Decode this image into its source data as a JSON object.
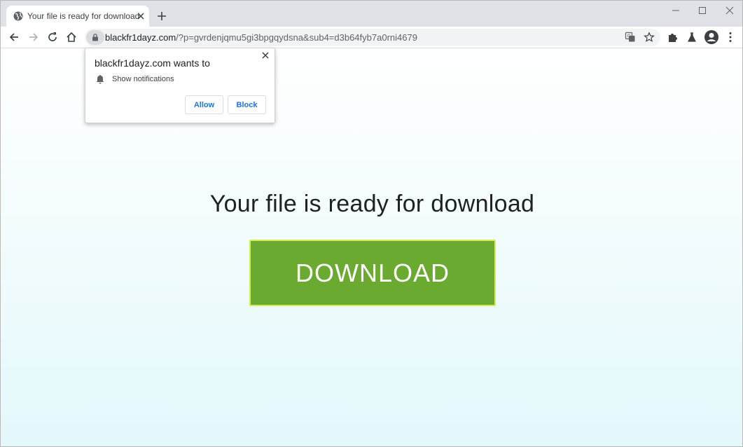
{
  "browser": {
    "tab": {
      "title": "Your file is ready for download",
      "favicon": "globe-icon"
    },
    "url": {
      "host": "blackfr1dayz.com",
      "path": "/?p=gvrdenjqmu5gi3bpgqydsna&sub4=d3b64fyb7a0rni4679"
    }
  },
  "popup": {
    "title": "blackfr1dayz.com wants to",
    "permission": "Show notifications",
    "allow_label": "Allow",
    "block_label": "Block"
  },
  "page": {
    "headline": "Your file is ready for download",
    "download_label": "DOWNLOAD",
    "download_color": "#6aaa30"
  }
}
